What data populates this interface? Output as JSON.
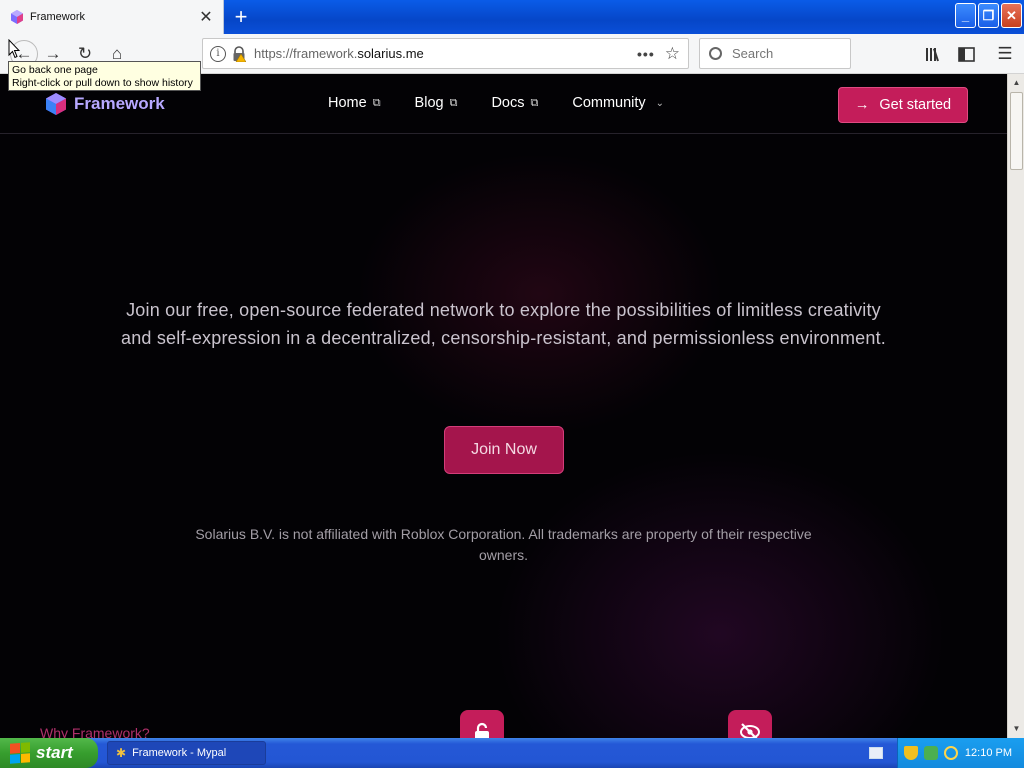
{
  "browser": {
    "tab_title": "Framework",
    "url_prefix": "https://framework.",
    "url_domain": "solarius.me",
    "search_placeholder": "Search",
    "tooltip_line1": "Go back one page",
    "tooltip_line2": "Right-click or pull down to show history",
    "icons": [
      "back-icon",
      "forward-icon",
      "reload-icon",
      "home-icon",
      "info-icon",
      "lock-icon",
      "page-actions-icon",
      "bookmark-star-icon",
      "library-icon",
      "sidebar-icon",
      "menu-icon"
    ]
  },
  "site": {
    "brand": "Framework",
    "nav": [
      {
        "label": "Home"
      },
      {
        "label": "Blog"
      },
      {
        "label": "Docs"
      },
      {
        "label": "Community"
      }
    ],
    "cta_label": "Get started",
    "hero_text": "Join our free, open-source federated network to explore the possibilities of limitless creativity and self-expression in a decentralized, censorship-resistant, and permissionless environment.",
    "join_label": "Join Now",
    "disclaimer": "Solarius B.V. is not affiliated with Roblox Corporation. All trademarks are property of their respective owners.",
    "why_label": "Why Framework?",
    "colors": {
      "accent": "#c41d5a",
      "brand": "#b7a8ff",
      "background": "#030205"
    }
  },
  "taskbar": {
    "start_label": "start",
    "task_label": "Framework - Mypal",
    "clock": "12:10 PM"
  }
}
